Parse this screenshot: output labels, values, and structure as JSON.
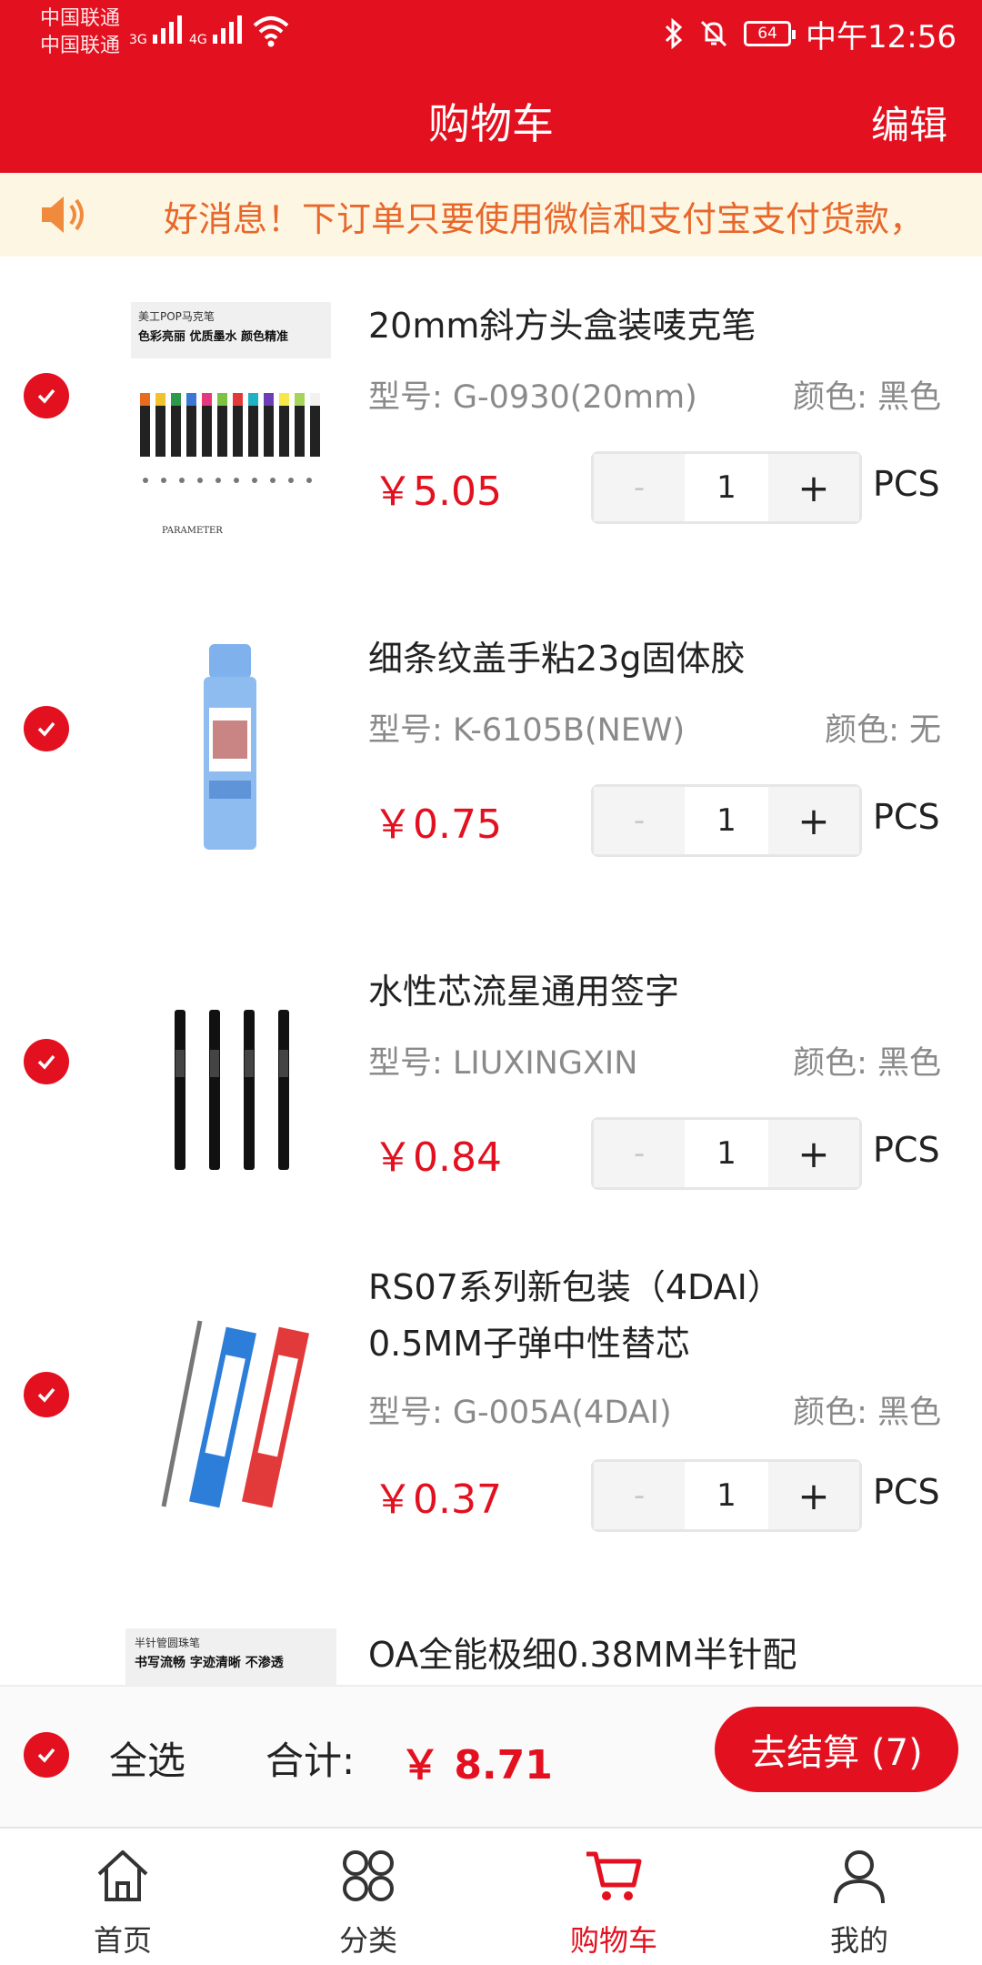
{
  "status_bar": {
    "carrier_1": "中国联通",
    "carrier_2": "中国联通",
    "sig1_label": "3G",
    "sig2_label": "4G",
    "battery": "64",
    "time": "中午12:56"
  },
  "header": {
    "title": "购物车",
    "edit_label": "编辑"
  },
  "notice": {
    "text": "好消息！下订单只要使用微信和支付宝支付货款，"
  },
  "cart_items": [
    {
      "name": "20mm斜方头盒装唛克笔",
      "model_label": "型号: G-0930(20mm)",
      "color_label": "颜色: 黑色",
      "price": "￥5.05",
      "quantity": "1",
      "unit": "PCS",
      "selected": true,
      "thumb_caption_1": "美工POP马克笔",
      "thumb_caption_2": "色彩亮丽 优质墨水 颜色精准",
      "thumb_caption_3": "PARAMETER"
    },
    {
      "name": "细条纹盖手粘23g固体胶",
      "model_label": "型号: K-6105B(NEW)",
      "color_label": "颜色: 无",
      "price": "￥0.75",
      "quantity": "1",
      "unit": "PCS",
      "selected": true
    },
    {
      "name": "水性芯流星通用签字",
      "model_label": "型号: LIUXINGXIN",
      "color_label": "颜色: 黑色",
      "price": "￥0.84",
      "quantity": "1",
      "unit": "PCS",
      "selected": true
    },
    {
      "name_line_1": "RS07系列新包装（4DAI）",
      "name_line_2": "0.5MM子弹中性替芯",
      "model_label": "型号: G-005A(4DAI)",
      "color_label": "颜色: 黑色",
      "price": "￥0.37",
      "quantity": "1",
      "unit": "PCS",
      "selected": true
    },
    {
      "name": "OA全能极细0.38MM半针配",
      "thumb_caption_1": "半针管圆珠笔",
      "thumb_caption_2": "书写流畅 字迹清晰 不渗透"
    }
  ],
  "qty_controls": {
    "minus": "-",
    "plus": "+"
  },
  "checkout": {
    "select_all": "全选",
    "total_label": "合计:",
    "total_value": "￥ 8.71",
    "pay_button": "去结算 (7)"
  },
  "tabbar": {
    "tabs": [
      {
        "label": "首页",
        "icon": "home-icon"
      },
      {
        "label": "分类",
        "icon": "category-icon"
      },
      {
        "label": "购物车",
        "icon": "cart-icon",
        "active": true
      },
      {
        "label": "我的",
        "icon": "user-icon"
      }
    ]
  },
  "colors": {
    "primary": "#e3101f",
    "notice_bg": "#fdf6e3",
    "notice_text": "#e8672a"
  }
}
